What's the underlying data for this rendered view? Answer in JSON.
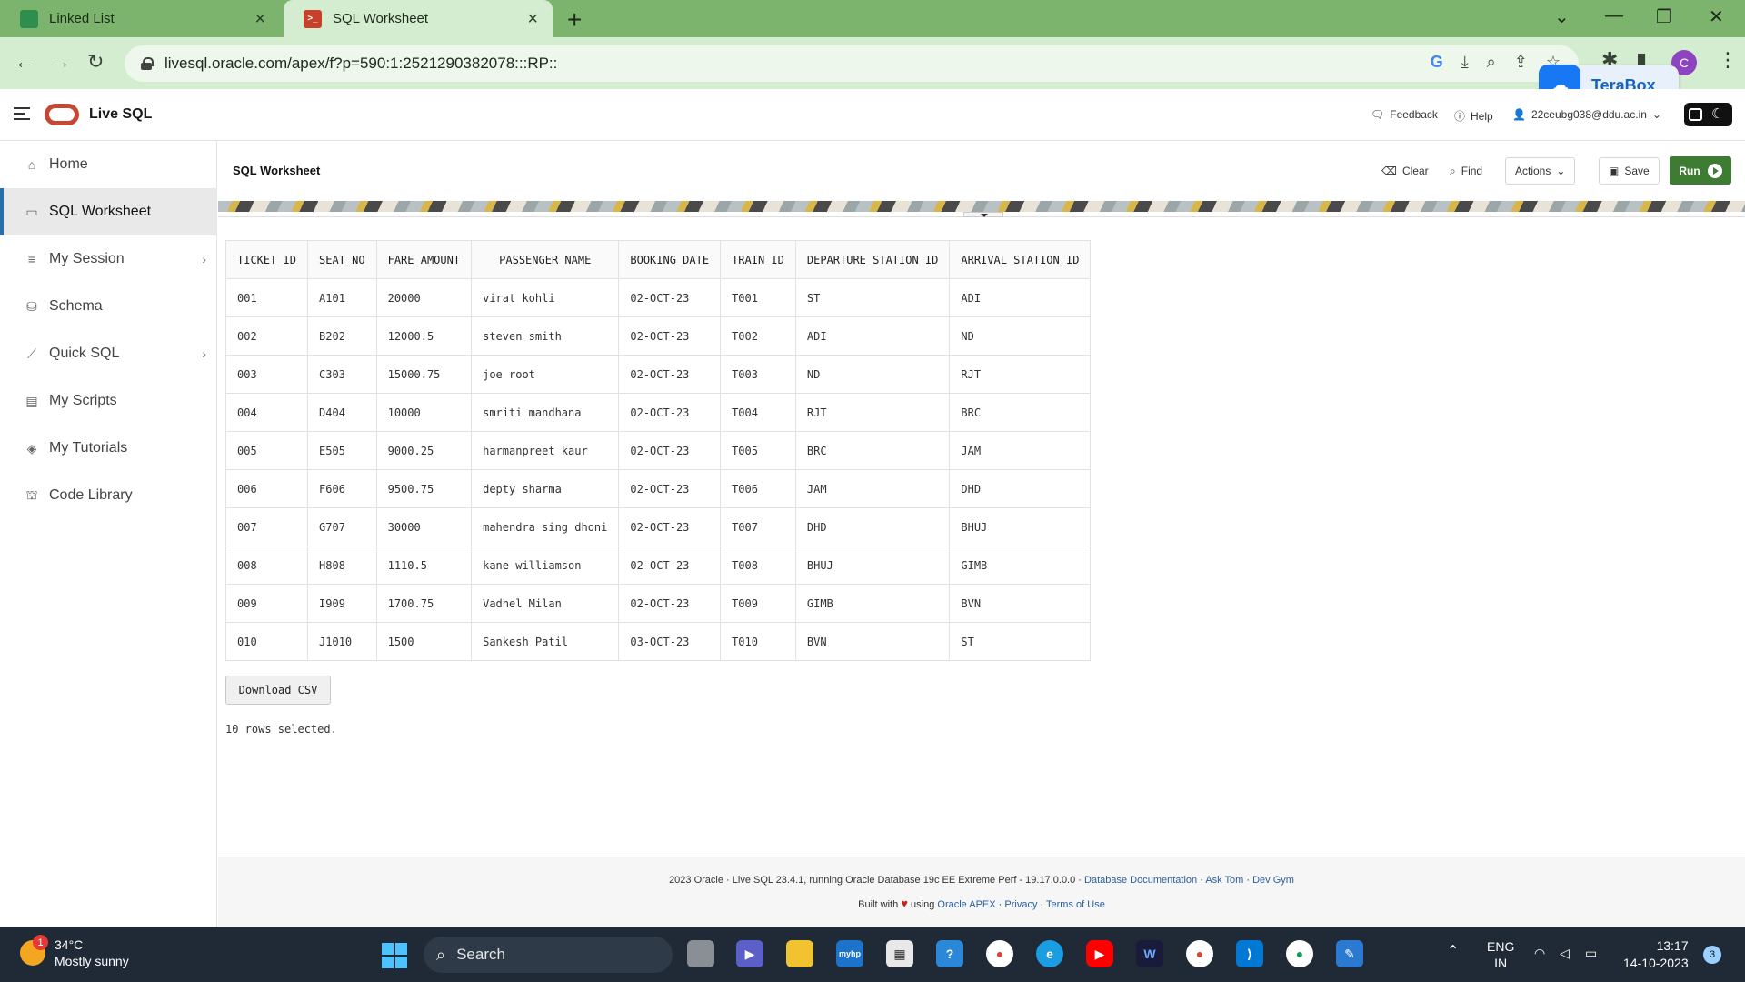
{
  "browser": {
    "tabs": [
      {
        "title": "Linked List",
        "active": false
      },
      {
        "title": "SQL Worksheet",
        "active": true
      }
    ],
    "url": "livesql.oracle.com/apex/f?p=590:1:2521290382078:::RP::",
    "profile_initial": "C",
    "terabox_label": "TeraBox"
  },
  "header": {
    "app_title": "Live SQL",
    "feedback": "Feedback",
    "help": "Help",
    "user": "22ceubg038@ddu.ac.in"
  },
  "sidebar": {
    "items": [
      {
        "label": "Home",
        "icon": "home-icon"
      },
      {
        "label": "SQL Worksheet",
        "icon": "worksheet-icon"
      },
      {
        "label": "My Session",
        "icon": "list-icon"
      },
      {
        "label": "Schema",
        "icon": "database-icon"
      },
      {
        "label": "Quick SQL",
        "icon": "wand-icon"
      },
      {
        "label": "My Scripts",
        "icon": "file-icon"
      },
      {
        "label": "My Tutorials",
        "icon": "graduation-cap-icon"
      },
      {
        "label": "Code Library",
        "icon": "library-icon"
      }
    ]
  },
  "worksheet": {
    "title": "SQL Worksheet",
    "clear": "Clear",
    "find": "Find",
    "actions": "Actions",
    "save": "Save",
    "run": "Run"
  },
  "results": {
    "columns": [
      "TICKET_ID",
      "SEAT_NO",
      "FARE_AMOUNT",
      "PASSENGER_NAME",
      "BOOKING_DATE",
      "TRAIN_ID",
      "DEPARTURE_STATION_ID",
      "ARRIVAL_STATION_ID"
    ],
    "rows": [
      [
        "001",
        "A101",
        "20000",
        "virat kohli",
        "02-OCT-23",
        "T001",
        "ST",
        "ADI"
      ],
      [
        "002",
        "B202",
        "12000.5",
        "steven smith",
        "02-OCT-23",
        "T002",
        "ADI",
        "ND"
      ],
      [
        "003",
        "C303",
        "15000.75",
        "joe root",
        "02-OCT-23",
        "T003",
        "ND",
        "RJT"
      ],
      [
        "004",
        "D404",
        "10000",
        "smriti mandhana",
        "02-OCT-23",
        "T004",
        "RJT",
        "BRC"
      ],
      [
        "005",
        "E505",
        "9000.25",
        "harmanpreet kaur",
        "02-OCT-23",
        "T005",
        "BRC",
        "JAM"
      ],
      [
        "006",
        "F606",
        "9500.75",
        "depty sharma",
        "02-OCT-23",
        "T006",
        "JAM",
        "DHD"
      ],
      [
        "007",
        "G707",
        "30000",
        "mahendra sing dhoni",
        "02-OCT-23",
        "T007",
        "DHD",
        "BHUJ"
      ],
      [
        "008",
        "H808",
        "1110.5",
        "kane williamson",
        "02-OCT-23",
        "T008",
        "BHUJ",
        "GIMB"
      ],
      [
        "009",
        "I909",
        "1700.75",
        "Vadhel Milan",
        "02-OCT-23",
        "T009",
        "GIMB",
        "BVN"
      ],
      [
        "010",
        "J1010",
        "1500",
        "Sankesh Patil",
        "03-OCT-23",
        "T010",
        "BVN",
        "ST"
      ]
    ],
    "download_label": "Download CSV",
    "summary": "10 rows selected."
  },
  "footer": {
    "line1_text": "2023 Oracle · Live SQL 23.4.1, running Oracle Database 19c EE Extreme Perf - 19.17.0.0.0 · ",
    "doc_link": "Database Documentation",
    "ask_tom": "Ask Tom",
    "dev_gym": "Dev Gym",
    "built_with": "Built with",
    "using": "using",
    "oracle_apex": "Oracle APEX",
    "privacy": "Privacy",
    "terms": "Terms of Use"
  },
  "taskbar": {
    "temperature": "34°C",
    "weather": "Mostly sunny",
    "weather_badge": "1",
    "search": "Search",
    "lang1": "ENG",
    "lang2": "IN",
    "time": "13:17",
    "date": "14-10-2023",
    "notifications": "3"
  },
  "colors": {
    "tab_strip": "#7cb46e",
    "address_bar": "#d4ecd0",
    "run_button": "#3e7b33",
    "oracle_red": "#c74634",
    "link": "#2a5f9e"
  }
}
